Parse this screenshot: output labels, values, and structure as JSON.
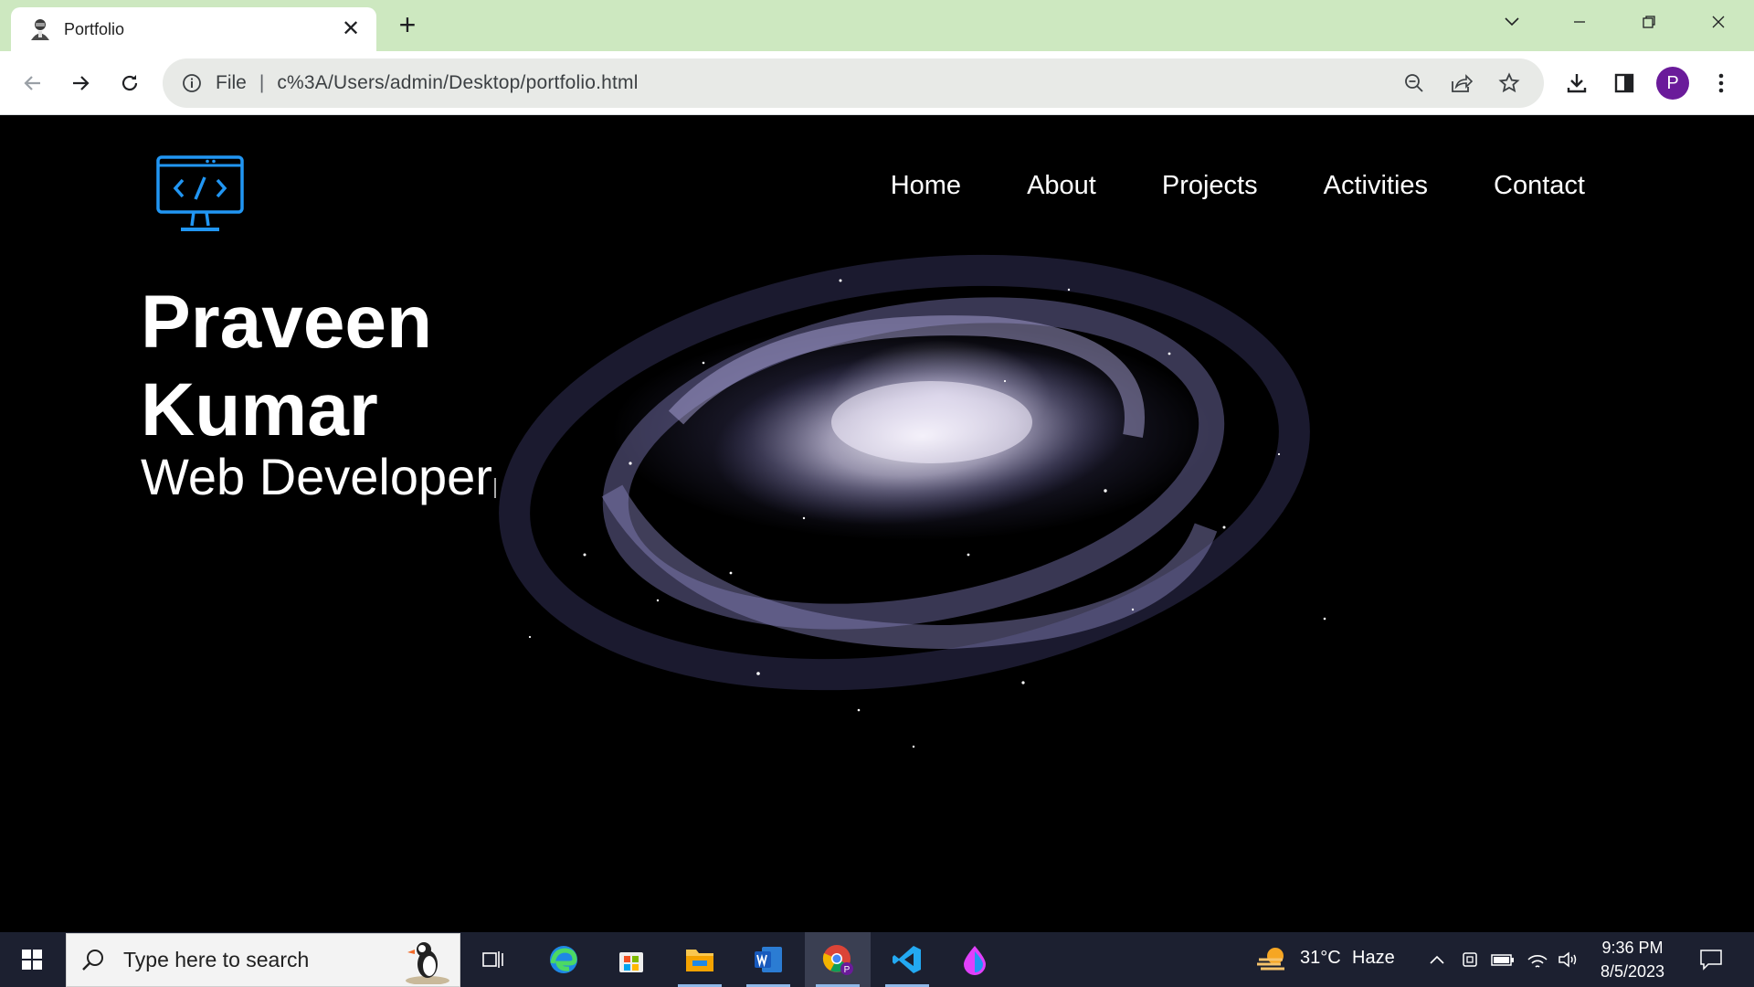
{
  "browser": {
    "tab_title": "Portfolio",
    "new_tab_label": "+",
    "omnibox": {
      "scheme_label": "File",
      "separator": "|",
      "url": "c%3A/Users/admin/Desktop/portfolio.html"
    },
    "profile_initial": "P"
  },
  "page": {
    "nav": {
      "items": [
        "Home",
        "About",
        "Projects",
        "Activities",
        "Contact"
      ]
    },
    "hero": {
      "name": "Praveen Kumar",
      "role": "Web Developer"
    },
    "logo_icon": "code-monitor-icon",
    "accent_color": "#2196f3",
    "background_color": "#000000"
  },
  "taskbar": {
    "search_placeholder": "Type here to search",
    "weather": {
      "temperature": "31°C",
      "condition": "Haze"
    },
    "clock": {
      "time": "9:36 PM",
      "date": "8/5/2023"
    },
    "apps": [
      "task-view-icon",
      "edge-icon",
      "microsoft-store-icon",
      "file-explorer-icon",
      "word-icon",
      "chrome-icon",
      "vscode-icon",
      "paint-icon"
    ],
    "color": "#1c2030"
  }
}
